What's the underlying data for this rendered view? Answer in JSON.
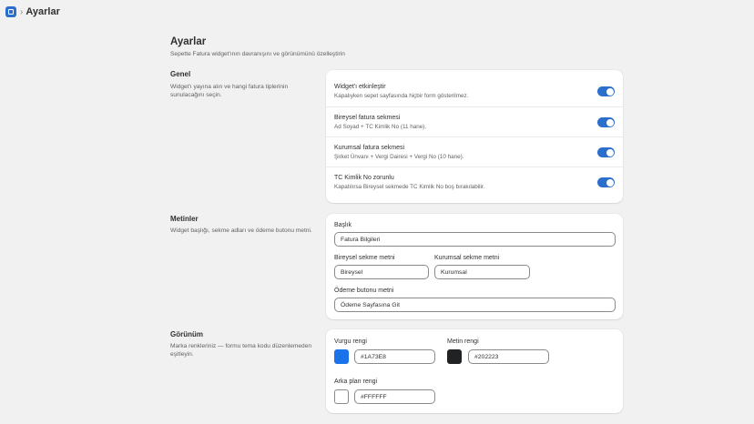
{
  "topbar": {
    "title": "Ayarlar"
  },
  "page": {
    "title": "Ayarlar",
    "subtitle": "Sepette Fatura widget'ının davranışını ve görünümünü özelleştirin"
  },
  "general": {
    "title": "Genel",
    "description": "Widget'ı yayına alın ve hangi fatura tiplerinin sunulacağını seçin.",
    "toggles": [
      {
        "label": "Widget'ı etkinleştir",
        "help": "Kapalıyken sepet sayfasında hiçbir form gösterilmez.",
        "on": true
      },
      {
        "label": "Bireysel fatura sekmesi",
        "help": "Ad Soyad + TC Kimlik No (11 hane).",
        "on": true
      },
      {
        "label": "Kurumsal fatura sekmesi",
        "help": "Şirket Ünvanı + Vergi Dairesi + Vergi No (10 hane).",
        "on": true
      },
      {
        "label": "TC Kimlik No zorunlu",
        "help": "Kapatılırsa Bireysel sekmede TC Kimlik No boş bırakılabilir.",
        "on": true
      }
    ]
  },
  "texts": {
    "title": "Metinler",
    "description": "Widget başlığı, sekme adları ve ödeme butonu metni.",
    "heading_label": "Başlık",
    "heading_value": "Fatura Bilgileri",
    "individual_label": "Bireysel sekme metni",
    "individual_value": "Bireysel",
    "corporate_label": "Kurumsal sekme metni",
    "corporate_value": "Kurumsal",
    "checkout_label": "Ödeme butonu metni",
    "checkout_value": "Ödeme Sayfasına Git"
  },
  "appearance": {
    "title": "Görünüm",
    "description": "Marka renkleriniz — formu tema kodu düzenlemeden eşitleyin.",
    "accent_label": "Vurgu rengi",
    "accent_value": "#1A73E8",
    "text_label": "Metin rengi",
    "text_value": "#202223",
    "bg_label": "Arka plan rengi",
    "bg_value": "#FFFFFF"
  },
  "colors": {
    "toggle_on": "#2C6ECB",
    "app_icon": "#2C6ECB"
  },
  "icons": {
    "app": "app-icon",
    "breadcrumb_separator": "chevron-right-icon"
  }
}
